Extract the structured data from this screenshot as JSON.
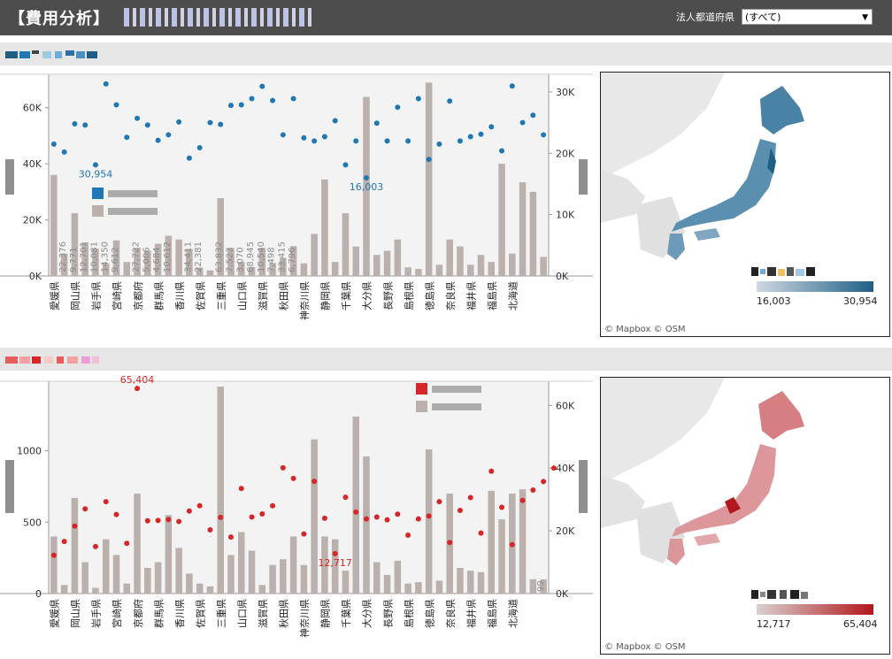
{
  "header": {
    "title": "【費用分析】",
    "filter_label": "法人都道府県",
    "filter_value": "(すべて)"
  },
  "colors": {
    "header_bg": "#4d4d4d",
    "bar": "#bab0ac",
    "blue_dot": "#1f77b4",
    "red_dot": "#d62728",
    "blue_scale": [
      "#cfd8e3",
      "#1f5f85"
    ],
    "red_scale": [
      "#d9d0cf",
      "#b2181b"
    ]
  },
  "prefectures": [
    "愛媛県",
    "岡山県",
    "岩手県",
    "宮崎県",
    "京都府",
    "群馬県",
    "香川県",
    "佐賀県",
    "三重県",
    "山口県",
    "滋賀県",
    "秋田県",
    "神奈川県",
    "静岡県",
    "千葉県",
    "大分県",
    "長野県",
    "島根県",
    "徳島県",
    "奈良県",
    "福井県",
    "福島県",
    "北海道"
  ],
  "chart1": {
    "left_axis_ticks": [
      "0K",
      "20K",
      "40K",
      "60K"
    ],
    "right_axis_ticks": [
      "0K",
      "10K",
      "20K",
      "30K"
    ],
    "legend_blue_swatch": "blue",
    "legend_gray_swatch": "gray",
    "labels": {
      "max_dot": "30,954",
      "min_dot": "16,003"
    }
  },
  "chart1_bar_labels": [
    "",
    "22,376",
    "9,771",
    "12,701",
    "10,081",
    "14,350",
    "9,612",
    "",
    "27,722",
    "5,006",
    "4,684",
    "10,612",
    "",
    "34,411",
    "22,381",
    "",
    "63,832",
    "7,523",
    "3,070",
    "68,945",
    "10,540",
    "7,498",
    "33,415",
    "6,796"
  ],
  "chart2": {
    "left_axis_ticks": [
      "0",
      "500",
      "1000"
    ],
    "right_axis_ticks": [
      "0K",
      "20K",
      "40K",
      "60K"
    ],
    "labels": {
      "max_dot": "65,404",
      "min_dot": "12,717",
      "last_bar": "99"
    }
  },
  "map1": {
    "legend_min": "16,003",
    "legend_max": "30,954",
    "credit": "© Mapbox  © OSM"
  },
  "map2": {
    "legend_min": "12,717",
    "legend_max": "65,404",
    "credit": "© Mapbox  © OSM"
  },
  "chart_data": [
    {
      "type": "bar",
      "categories": [
        "愛媛県",
        "",
        "岡山県",
        "",
        "岩手県",
        "",
        "宮崎県",
        "",
        "京都府",
        "",
        "群馬県",
        "",
        "香川県",
        "",
        "佐賀県",
        "",
        "三重県",
        "",
        "山口県",
        "",
        "滋賀県",
        "",
        "秋田県",
        "",
        "神奈川県",
        "",
        "静岡県",
        "",
        "千葉県",
        "",
        "大分県",
        "",
        "長野県",
        "",
        "島根県",
        "",
        "徳島県",
        "",
        "奈良県",
        "",
        "福井県",
        "",
        "福島県",
        "",
        "北海道",
        ""
      ],
      "series": [
        {
          "values": [
            36000,
            8000,
            22376,
            12000,
            9771,
            4500,
            12701,
            5000,
            10081,
            9000,
            11500,
            14350,
            13000,
            9612,
            3000,
            2000,
            27722,
            10000,
            5006,
            3200,
            10000,
            4684,
            6500,
            10612,
            4500,
            15000,
            34411,
            5000,
            22381,
            10500,
            63832,
            7523,
            9000,
            13000,
            3070,
            2500,
            68945,
            4000,
            13000,
            10540,
            4000,
            7498,
            5000,
            40000,
            8000,
            33415,
            30000,
            6796
          ]
        },
        {
          "values": [
            21500,
            20200,
            24800,
            24600,
            18100,
            31300,
            27900,
            22600,
            25700,
            24600,
            22100,
            23000,
            25100,
            19200,
            20900,
            25000,
            24700,
            27800,
            27900,
            28900,
            30900,
            28600,
            23000,
            28900,
            22500,
            22000,
            22700,
            25300,
            18100,
            22000,
            16003,
            24900,
            22000,
            27500,
            22000,
            28900,
            19000,
            21500,
            28500,
            22000,
            22700,
            23100,
            24300,
            20400,
            30954,
            25000,
            26200,
            23000
          ]
        }
      ],
      "y_left_lim": [
        0,
        70000
      ],
      "y_right_lim": [
        0,
        32000
      ]
    },
    {
      "type": "bar",
      "categories": [
        "愛媛県",
        "",
        "岡山県",
        "",
        "岩手県",
        "",
        "宮崎県",
        "",
        "京都府",
        "",
        "群馬県",
        "",
        "香川県",
        "",
        "佐賀県",
        "",
        "三重県",
        "",
        "山口県",
        "",
        "滋賀県",
        "",
        "秋田県",
        "",
        "神奈川県",
        "",
        "静岡県",
        "",
        "千葉県",
        "",
        "大分県",
        "",
        "長野県",
        "",
        "島根県",
        "",
        "徳島県",
        "",
        "奈良県",
        "",
        "福井県",
        "",
        "福島県",
        "",
        "北海道",
        ""
      ],
      "series": [
        {
          "values": [
            400,
            60,
            670,
            220,
            40,
            380,
            270,
            70,
            700,
            180,
            220,
            550,
            320,
            140,
            70,
            50,
            1450,
            270,
            430,
            300,
            60,
            200,
            240,
            400,
            200,
            1080,
            400,
            380,
            160,
            1240,
            960,
            220,
            130,
            230,
            70,
            80,
            1010,
            90,
            700,
            180,
            160,
            150,
            720,
            520,
            700,
            730,
            100,
            99
          ]
        },
        {
          "values": [
            12200,
            16600,
            21500,
            27000,
            15000,
            29300,
            25200,
            16000,
            65404,
            23200,
            23300,
            23600,
            23000,
            26300,
            28000,
            20300,
            24300,
            18000,
            33500,
            24400,
            25400,
            28000,
            40100,
            36700,
            19000,
            35800,
            24000,
            12717,
            30700,
            26000,
            23800,
            24400,
            23500,
            25300,
            18600,
            23800,
            24700,
            29300,
            16300,
            26500,
            30600,
            19300,
            39000,
            27500,
            15600,
            29700,
            33000,
            35700,
            40000
          ]
        }
      ],
      "y_left_lim": [
        0,
        1450
      ],
      "y_right_lim": [
        0,
        66000
      ]
    }
  ]
}
